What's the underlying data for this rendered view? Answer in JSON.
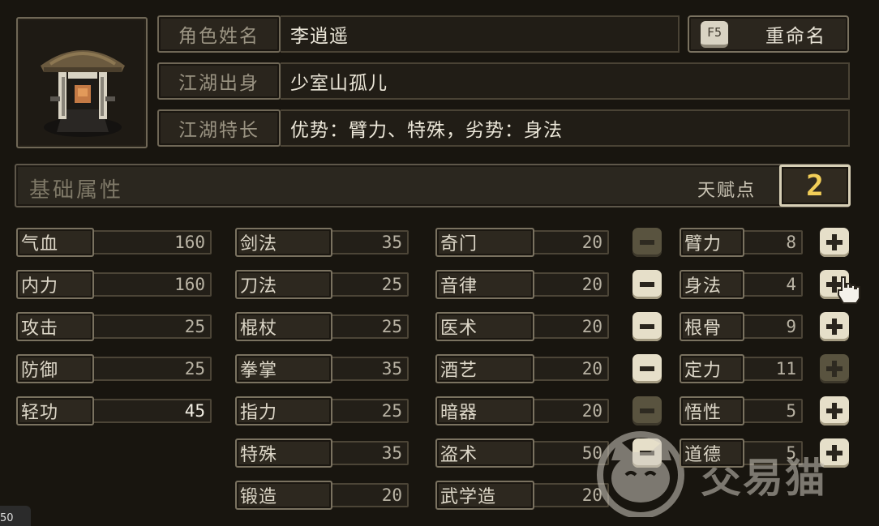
{
  "character": {
    "name_label": "角色姓名",
    "name_value": "李逍遥",
    "origin_label": "江湖出身",
    "origin_value": "少室山孤儿",
    "traits_label": "江湖特长",
    "traits_value": "优势：臂力、特殊，劣势：身法",
    "rename_key": "F5",
    "rename_label": "重命名",
    "portrait_icon": "straw-hat-swordsman-portrait"
  },
  "base_attributes": {
    "title": "基础属性",
    "talent_points_label": "天赋点",
    "talent_points_value": "2"
  },
  "combat_stats": [
    {
      "label": "气血",
      "value": "160"
    },
    {
      "label": "内力",
      "value": "160"
    },
    {
      "label": "攻击",
      "value": "25"
    },
    {
      "label": "防御",
      "value": "25"
    },
    {
      "label": "轻功",
      "value": "45"
    }
  ],
  "weapon_skills": [
    {
      "label": "剑法",
      "value": "35"
    },
    {
      "label": "刀法",
      "value": "25"
    },
    {
      "label": "棍杖",
      "value": "25"
    },
    {
      "label": "拳掌",
      "value": "35"
    },
    {
      "label": "指力",
      "value": "25"
    },
    {
      "label": "特殊",
      "value": "35"
    },
    {
      "label": "锻造",
      "value": "20"
    }
  ],
  "arts_skills": [
    {
      "label": "奇门",
      "value": "20"
    },
    {
      "label": "音律",
      "value": "20"
    },
    {
      "label": "医术",
      "value": "20"
    },
    {
      "label": "酒艺",
      "value": "20"
    },
    {
      "label": "暗器",
      "value": "20"
    },
    {
      "label": "盗术",
      "value": "50"
    },
    {
      "label": "武学造",
      "value": "20"
    }
  ],
  "talents": [
    {
      "label": "臂力",
      "value": "8",
      "minus_enabled": false,
      "plus_enabled": true
    },
    {
      "label": "身法",
      "value": "4",
      "minus_enabled": true,
      "plus_enabled": true
    },
    {
      "label": "根骨",
      "value": "9",
      "minus_enabled": true,
      "plus_enabled": true
    },
    {
      "label": "定力",
      "value": "11",
      "minus_enabled": true,
      "plus_enabled": false
    },
    {
      "label": "悟性",
      "value": "5",
      "minus_enabled": false,
      "plus_enabled": true
    },
    {
      "label": "道德",
      "value": "5",
      "minus_enabled": true,
      "plus_enabled": true
    }
  ],
  "watermark": {
    "text": "交易猫"
  },
  "corner_tag": {
    "text": "50"
  },
  "colors": {
    "accent_gold": "#f2ce58",
    "panel_border": "#6f6756",
    "background": "#18150f"
  }
}
